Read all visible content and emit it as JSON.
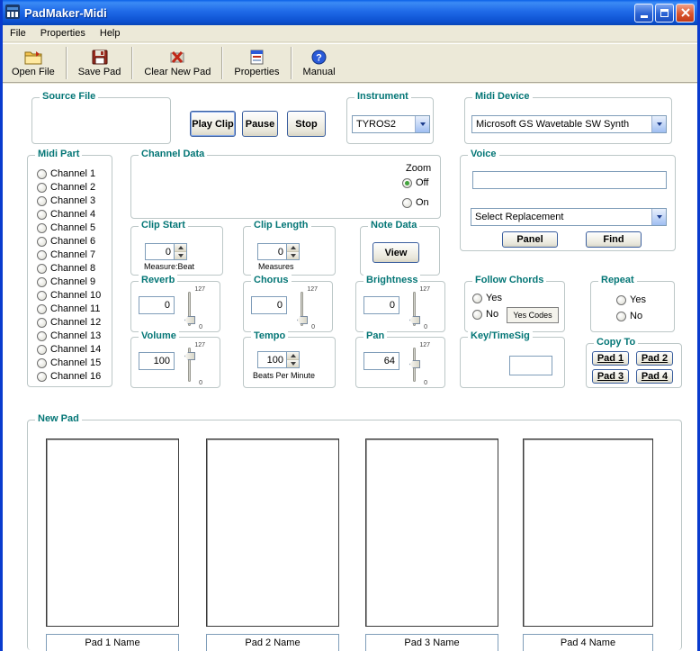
{
  "window": {
    "title": "PadMaker-Midi"
  },
  "menu": {
    "items": [
      "File",
      "Properties",
      "Help"
    ]
  },
  "toolbar": {
    "items": [
      {
        "label": "Open File"
      },
      {
        "label": "Save Pad"
      },
      {
        "label": "Clear New Pad"
      },
      {
        "label": "Properties"
      },
      {
        "label": "Manual",
        "glyph": "?"
      }
    ]
  },
  "source_file": {
    "title": "Source File"
  },
  "transport": {
    "play": "Play Clip",
    "pause": "Pause",
    "stop": "Stop"
  },
  "instrument": {
    "title": "Instrument",
    "value": "TYROS2"
  },
  "midi_device": {
    "title": "Midi Device",
    "value": "Microsoft GS Wavetable SW Synth"
  },
  "midi_part": {
    "title": "Midi Part",
    "channels": [
      "Channel 1",
      "Channel 2",
      "Channel 3",
      "Channel 4",
      "Channel 5",
      "Channel 6",
      "Channel 7",
      "Channel 8",
      "Channel 9",
      "Channel 10",
      "Channel 11",
      "Channel 12",
      "Channel 13",
      "Channel 14",
      "Channel 15",
      "Channel 16"
    ]
  },
  "channel_data": {
    "title": "Channel Data",
    "zoom_label": "Zoom",
    "zoom_off": "Off",
    "zoom_on": "On"
  },
  "voice": {
    "title": "Voice",
    "value": "",
    "replacement": "Select Replacement",
    "panel": "Panel",
    "find": "Find"
  },
  "clip_start": {
    "title": "Clip Start",
    "value": "0",
    "unit": "Measure:Beat"
  },
  "clip_length": {
    "title": "Clip Length",
    "value": "0",
    "unit": "Measures"
  },
  "note_data": {
    "title": "Note Data",
    "view": "View"
  },
  "reverb": {
    "title": "Reverb",
    "value": "0",
    "max": "127",
    "min": "0"
  },
  "chorus": {
    "title": "Chorus",
    "value": "0",
    "max": "127",
    "min": "0"
  },
  "brightness": {
    "title": "Brightness",
    "value": "0",
    "max": "127",
    "min": "0"
  },
  "follow_chords": {
    "title": "Follow Chords",
    "yes": "Yes",
    "no": "No",
    "yes_codes": "Yes Codes"
  },
  "repeat": {
    "title": "Repeat",
    "yes": "Yes",
    "no": "No"
  },
  "volume": {
    "title": "Volume",
    "value": "100",
    "max": "127",
    "min": "0"
  },
  "tempo": {
    "title": "Tempo",
    "value": "100",
    "unit": "Beats Per Minute"
  },
  "pan": {
    "title": "Pan",
    "value": "64",
    "max": "127",
    "min": "0"
  },
  "key_timesig": {
    "title": "Key/TimeSig",
    "value": ""
  },
  "copy_to": {
    "title": "Copy To",
    "pads": [
      "Pad 1",
      "Pad 2",
      "Pad 3",
      "Pad 4"
    ]
  },
  "new_pad": {
    "title": "New Pad",
    "pad_names": [
      "Pad 1 Name",
      "Pad 2 Name",
      "Pad 3 Name",
      "Pad 4 Name"
    ]
  }
}
